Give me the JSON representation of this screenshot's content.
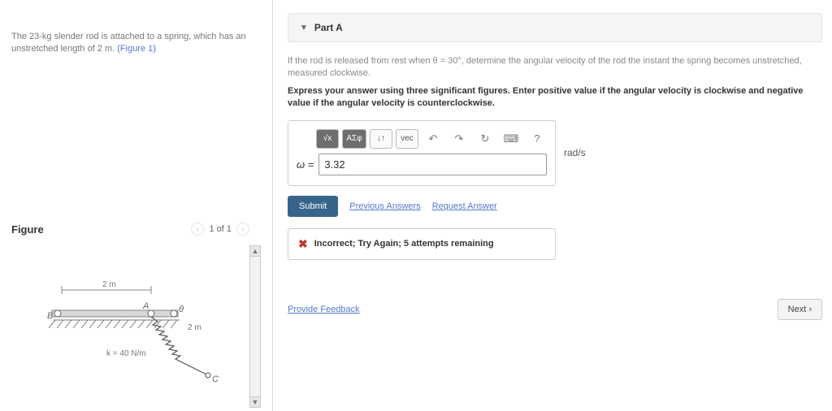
{
  "problem": {
    "text_pre": "The 23-kg slender rod is attached to a spring, which has an unstretched length of 2 m. ",
    "figure_ref": "(Figure 1)"
  },
  "figure": {
    "title": "Figure",
    "counter": "1 of 1",
    "label_top": "2 m",
    "label_side": "2 m",
    "label_B": "B",
    "label_A": "A",
    "label_C": "C",
    "label_theta": "θ",
    "label_k": "k = 40 N/m"
  },
  "part": {
    "title": "Part A",
    "question": "If the rod is released from rest when θ = 30°, determine the angular velocity of the rod the instant the spring becomes unstretched, measured clockwise.",
    "instruction": "Express your answer using three significant figures. Enter positive value if the angular velocity is clockwise and negative value if the angular velocity is counterclockwise.",
    "var_label": "ω =",
    "value": "3.32",
    "units": "rad/s",
    "toolbar": {
      "t1": "√x",
      "t2": "ΑΣφ",
      "t3": "↓↑",
      "t4": "vec",
      "t5": "↶",
      "t6": "↷",
      "t7": "↻",
      "t8": "⌨",
      "t9": "?"
    },
    "submit": "Submit",
    "prev_answers": "Previous Answers",
    "request_answer": "Request Answer",
    "feedback": "Incorrect; Try Again; 5 attempts remaining"
  },
  "footer": {
    "provide": "Provide Feedback",
    "next": "Next ›"
  }
}
